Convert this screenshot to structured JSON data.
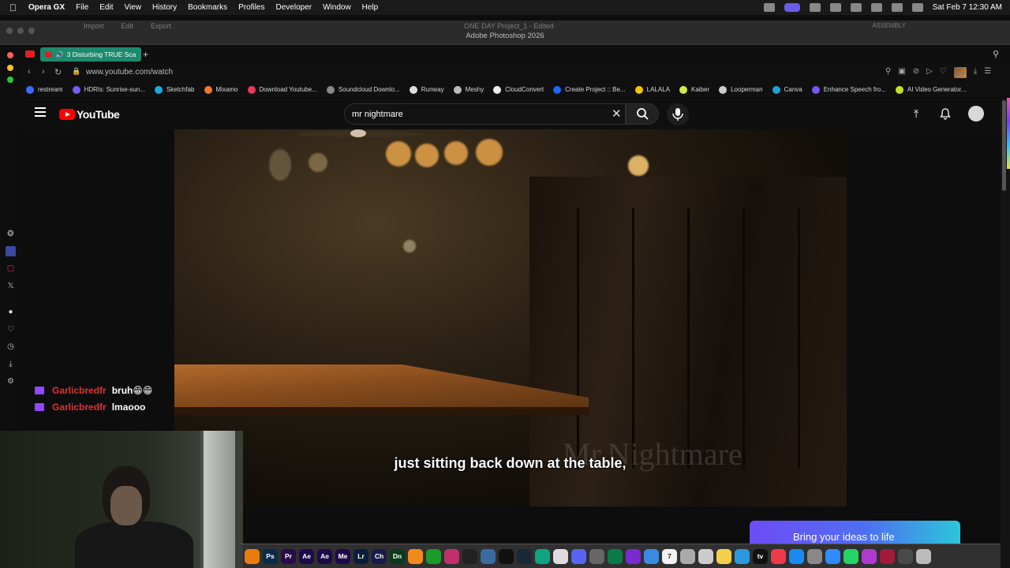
{
  "menubar": {
    "app_name": "Opera GX",
    "items": [
      "File",
      "Edit",
      "View",
      "History",
      "Bookmarks",
      "Profiles",
      "Developer",
      "Window",
      "Help"
    ],
    "clock": "Sat Feb 7  12:30 AM"
  },
  "photoshop": {
    "menu": [
      "Import",
      "Edit",
      "Export"
    ],
    "doc_name": "ONE DAY Project_1 - Edited",
    "window_title": "Adobe Photoshop 2026",
    "workspace": "ASSEMBLY"
  },
  "browser": {
    "active_tab_title": "3 Disturbing TRUE Sca",
    "url": "www.youtube.com/watch",
    "bookmarks": [
      {
        "label": "restream",
        "color": "#3b6cff"
      },
      {
        "label": "HDRIs: Sunrise-sun...",
        "color": "#7a5af8"
      },
      {
        "label": "Sketchfab",
        "color": "#1caad9"
      },
      {
        "label": "Mixamo",
        "color": "#f07a2c"
      },
      {
        "label": "Download Youtube...",
        "color": "#e33b5c"
      },
      {
        "label": "Soundcloud Downlo...",
        "color": "#888888"
      },
      {
        "label": "Runway",
        "color": "#dddddd"
      },
      {
        "label": "Meshy",
        "color": "#bbbbbb"
      },
      {
        "label": "CloudConvert",
        "color": "#eeeeee"
      },
      {
        "label": "Create Project :: Be...",
        "color": "#1769ff"
      },
      {
        "label": "LALALA",
        "color": "#f5c400"
      },
      {
        "label": "Kaiber",
        "color": "#d4e84a"
      },
      {
        "label": "Looperman",
        "color": "#cccccc"
      },
      {
        "label": "Canva",
        "color": "#1aa3d6"
      },
      {
        "label": "Enhance Speech fro...",
        "color": "#7b55f5"
      },
      {
        "label": "AI Video Generator...",
        "color": "#c7e02a"
      }
    ]
  },
  "youtube": {
    "logo_text": "YouTube",
    "search_value": "mr nightmare",
    "caption": "just sitting back down at the table,",
    "watermark": "Mr.Nightmare"
  },
  "chat": [
    {
      "user": "Garlicbredfr",
      "message": "bruh😁😁"
    },
    {
      "user": "Garlicbredfr",
      "message": "lmaooo"
    }
  ],
  "promo": {
    "text": "Bring your ideas to life"
  },
  "dock_apps": [
    {
      "name": "blender",
      "label": "",
      "color": "#e87d0d"
    },
    {
      "name": "photoshop",
      "label": "Ps",
      "color": "#0b2a4a"
    },
    {
      "name": "premiere",
      "label": "Pr",
      "color": "#2a0a4a"
    },
    {
      "name": "after-effects",
      "label": "Ae",
      "color": "#1d0a4a"
    },
    {
      "name": "after-effects-beta",
      "label": "Ae",
      "color": "#1d0a4a"
    },
    {
      "name": "media-encoder",
      "label": "Me",
      "color": "#1d0a4a"
    },
    {
      "name": "lightroom",
      "label": "Lr",
      "color": "#0a1e3a"
    },
    {
      "name": "character-animator",
      "label": "Ch",
      "color": "#1a1a4a"
    },
    {
      "name": "dimension",
      "label": "Dn",
      "color": "#0a3a1a"
    },
    {
      "name": "fl-studio",
      "label": "",
      "color": "#f08a1a"
    },
    {
      "name": "green-app",
      "label": "",
      "color": "#1a9a2a"
    },
    {
      "name": "opera-gx",
      "label": "",
      "color": "#c0306a"
    },
    {
      "name": "obs",
      "label": "",
      "color": "#222222"
    },
    {
      "name": "davinci",
      "label": "",
      "color": "#3a6aa0"
    },
    {
      "name": "capcut",
      "label": "",
      "color": "#111111"
    },
    {
      "name": "steam",
      "label": "",
      "color": "#1b2838"
    },
    {
      "name": "chatgpt",
      "label": "",
      "color": "#10a37f"
    },
    {
      "name": "chrome",
      "label": "",
      "color": "#dddddd"
    },
    {
      "name": "discord",
      "label": "",
      "color": "#5865f2"
    },
    {
      "name": "utility",
      "label": "",
      "color": "#666666"
    },
    {
      "name": "terminal-green",
      "label": "",
      "color": "#0a7a4a"
    },
    {
      "name": "purple-app",
      "label": "",
      "color": "#7a2ad0"
    },
    {
      "name": "finder",
      "label": "",
      "color": "#3a8ae0"
    },
    {
      "name": "calendar",
      "label": "7",
      "color": "#f2f2f2"
    },
    {
      "name": "preview",
      "label": "",
      "color": "#aaaaaa"
    },
    {
      "name": "launchpad",
      "label": "",
      "color": "#cccccc"
    },
    {
      "name": "notes",
      "label": "",
      "color": "#f5d04a"
    },
    {
      "name": "safari",
      "label": "",
      "color": "#2a9ae0"
    },
    {
      "name": "apple-tv",
      "label": "tv",
      "color": "#111111"
    },
    {
      "name": "news",
      "label": "",
      "color": "#f03a4a"
    },
    {
      "name": "app-store",
      "label": "",
      "color": "#1a8af0"
    },
    {
      "name": "settings",
      "label": "",
      "color": "#888888"
    },
    {
      "name": "zoom",
      "label": "",
      "color": "#2d8cff"
    },
    {
      "name": "whatsapp",
      "label": "",
      "color": "#25d366"
    },
    {
      "name": "messenger",
      "label": "",
      "color": "#b03ad0"
    },
    {
      "name": "davinci-red",
      "label": "",
      "color": "#a01a3a"
    },
    {
      "name": "thumbnail-app",
      "label": "",
      "color": "#4a4a4a"
    },
    {
      "name": "trash",
      "label": "",
      "color": "#bbbbbb"
    }
  ]
}
